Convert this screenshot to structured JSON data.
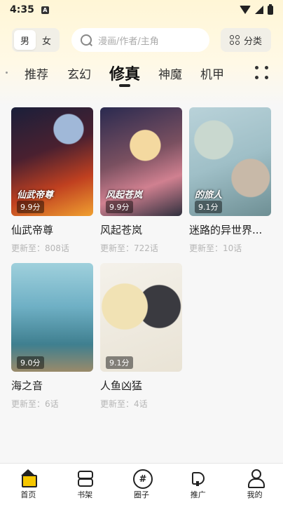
{
  "status_bar": {
    "time": "4:35",
    "notif_letter": "A"
  },
  "header": {
    "gender_options": [
      "男",
      "女"
    ],
    "search_placeholder": "漫画/作者/主角",
    "category_label": "分类"
  },
  "tabs": [
    "推荐",
    "玄幻",
    "修真",
    "神魔",
    "机甲"
  ],
  "active_tab": "修真",
  "comics": [
    {
      "title": "仙武帝尊",
      "rating": "9.9分",
      "update": "更新至：808话",
      "cover_text": "仙武帝尊"
    },
    {
      "title": "风起苍岚",
      "rating": "9.9分",
      "update": "更新至：722话",
      "cover_text": "风起苍岚"
    },
    {
      "title": "迷路的异世界...",
      "rating": "9.1分",
      "update": "更新至：10话",
      "cover_text": "的旅人"
    },
    {
      "title": "海之音",
      "rating": "9.0分",
      "update": "更新至：6话",
      "cover_text": ""
    },
    {
      "title": "人鱼凶猛",
      "rating": "9.1分",
      "update": "更新至：4话",
      "cover_text": ""
    }
  ],
  "bottom_nav": [
    {
      "label": "首页",
      "icon": "home-icon"
    },
    {
      "label": "书架",
      "icon": "bookshelf-icon"
    },
    {
      "label": "圈子",
      "icon": "hashtag-icon"
    },
    {
      "label": "推广",
      "icon": "megaphone-icon"
    },
    {
      "label": "我的",
      "icon": "person-icon"
    }
  ],
  "colors": {
    "accent": "#f6c700",
    "header_bg": "#fff6d6"
  }
}
